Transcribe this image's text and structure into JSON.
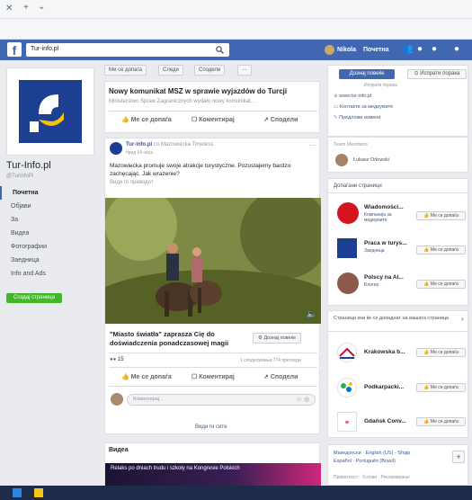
{
  "browser": {
    "close": "✕",
    "new_tab": "+",
    "dropdown": "⌄"
  },
  "topbar": {
    "logo": "f",
    "search_value": "Tur-info.pl",
    "user": "Nikola",
    "home": "Почетна"
  },
  "page_tabs": {
    "like": "Ме се допаѓа",
    "follow": "Следи",
    "share": "Сподели",
    "more": "···"
  },
  "left": {
    "page_name": "Tur-Info.pl",
    "handle": "@TurInfoPl",
    "nav": [
      "Почетна",
      "Објави",
      "За",
      "Видеа",
      "Фотографии",
      "Заедница",
      "Info and Ads"
    ],
    "create_page": "Создај страница"
  },
  "posts": {
    "p1_title": "Nowy komunikat MSZ w sprawie wyjazdów do Turcji",
    "p1_sub": "Ministerstwo Spraw Zagranicznych wydało nowy komunikat...",
    "like": "Ме се допаѓа",
    "comment": "Коментирај",
    "share": "Сподели",
    "p2_author": "Tur-info.pl",
    "p2_with": "со Mazowiecka Timeless",
    "p2_time": "пред 14 часа",
    "p2_text": "Mazowiecka promuje swoje atrakcje turystyczne. Pozostajemy bardzo zachęcając. Jak wrażenie?",
    "p2_see": "Види го преводот",
    "video_caption": "\"Miasto światła\" zaprasza Cię do doświadczenia ponadczasowej magii",
    "learn_more": "Дознај повеќе",
    "reactions": "15",
    "shares": "1 споделувања  774 прегледи",
    "comment_ph": "Коментирај...",
    "see_all": "Види ги сите",
    "videos_header": "Видеа",
    "video_strip": "Relaks po dniach trudu i szkoły na Kongresie Polskich"
  },
  "right": {
    "learn_btn": "Дознај повеќе",
    "send_btn": "Испрати порака",
    "send_msg": "Испрати порака",
    "website": "www.tur-info.pl",
    "contact": "Контакти за медиумите",
    "suggest": "Предложи измени",
    "team_header": "Team Members",
    "team_member": "Łukasz Orłowski",
    "liked_header": "Допаѓани страници",
    "liked": [
      {
        "name": "Wiadomości...",
        "sub": "Компанија за медиумите",
        "btn": "Ме се допаѓа"
      },
      {
        "name": "Praca w turys...",
        "sub": "Заедница",
        "btn": "Ме се допаѓа"
      },
      {
        "name": "Polscy na Al...",
        "sub": "Блогер",
        "btn": "Ме се допаѓа"
      }
    ],
    "suggest_header": "Страници кои ќе се допаднат на вашата страница",
    "suggested": [
      {
        "name": "Krakowska b...",
        "btn": "Ме се допаѓа"
      },
      {
        "name": "Podkarpacki...",
        "btn": "Ме се допаѓа"
      },
      {
        "name": "Gdańsk Conv...",
        "btn": "Ме се допаѓа"
      }
    ],
    "lang_line1": "Македонски · English (US) · Shqip",
    "lang_line2": "Español · Português (Brasil)",
    "footer": "Приватност · Услови · Рекламирање"
  }
}
